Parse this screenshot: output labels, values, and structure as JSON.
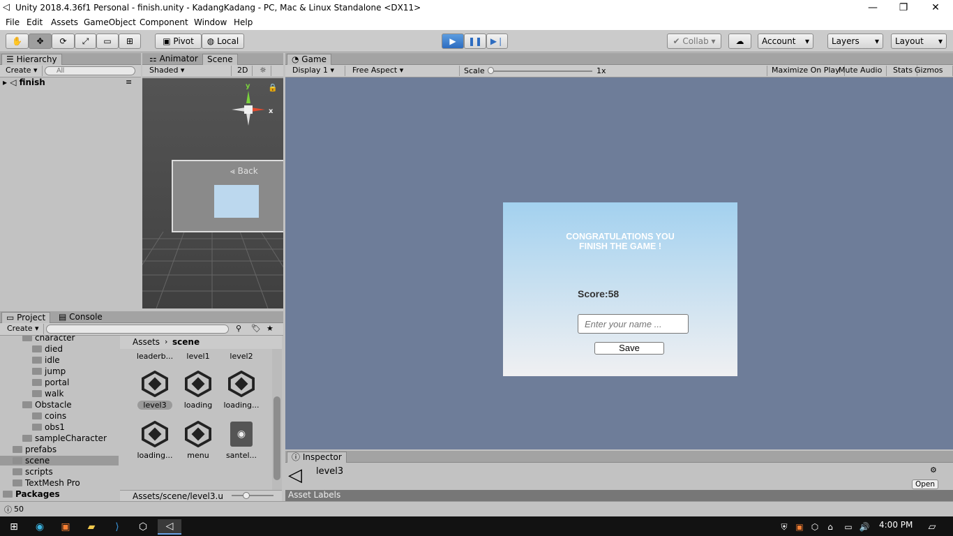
{
  "window": {
    "title": "Unity 2018.4.36f1 Personal - finish.unity - KadangKadang - PC, Mac & Linux Standalone <DX11>"
  },
  "menu": [
    "File",
    "Edit",
    "Assets",
    "GameObject",
    "Component",
    "Window",
    "Help"
  ],
  "toolbar": {
    "pivot": "Pivot",
    "local": "Local",
    "collab": "Collab",
    "account": "Account",
    "layers": "Layers",
    "layout": "Layout"
  },
  "hierarchy": {
    "tab": "Hierarchy",
    "create": "Create",
    "search_placeholder": "All",
    "scene": "finish"
  },
  "scene_panel": {
    "tab_animator": "Animator",
    "tab_scene": "Scene",
    "shading": "Shaded",
    "mode2d": "2D",
    "back": "Back",
    "axis_y": "y",
    "axis_x": "x"
  },
  "game": {
    "tab": "Game",
    "display": "Display 1",
    "aspect": "Free Aspect",
    "scale_label": "Scale",
    "scale_value": "1x",
    "maximize": "Maximize On Play",
    "mute": "Mute Audio",
    "stats": "Stats",
    "gizmos": "Gizmos"
  },
  "finish_dialog": {
    "title_line1": "CONGRATULATIONS YOU",
    "title_line2": "FINISH THE GAME !",
    "score": "Score:58",
    "name_placeholder": "Enter your name ...",
    "save": "Save"
  },
  "project": {
    "tab_project": "Project",
    "tab_console": "Console",
    "create": "Create",
    "tree": [
      {
        "label": "character",
        "indent": 2
      },
      {
        "label": "died",
        "indent": 3
      },
      {
        "label": "idle",
        "indent": 3
      },
      {
        "label": "jump",
        "indent": 3
      },
      {
        "label": "portal",
        "indent": 3
      },
      {
        "label": "walk",
        "indent": 3
      },
      {
        "label": "Obstacle",
        "indent": 2
      },
      {
        "label": "coins",
        "indent": 3
      },
      {
        "label": "obs1",
        "indent": 3
      },
      {
        "label": "sampleCharacter",
        "indent": 2
      },
      {
        "label": "prefabs",
        "indent": 1
      },
      {
        "label": "scene",
        "indent": 1
      },
      {
        "label": "scripts",
        "indent": 1
      },
      {
        "label": "TextMesh Pro",
        "indent": 1
      },
      {
        "label": "Packages",
        "indent": 0
      }
    ],
    "breadcrumb_root": "Assets",
    "breadcrumb_leaf": "scene",
    "assets_top": [
      "leaderb...",
      "level1",
      "level2"
    ],
    "assets": [
      "level3",
      "loading",
      "loading...",
      "loading...",
      "menu",
      "santel..."
    ],
    "footer_path": "Assets/scene/level3.u"
  },
  "inspector": {
    "tab": "Inspector",
    "object": "level3",
    "open": "Open",
    "labels": "Asset Labels"
  },
  "status": {
    "count": "50"
  },
  "taskbar": {
    "time": "4:00 PM"
  }
}
